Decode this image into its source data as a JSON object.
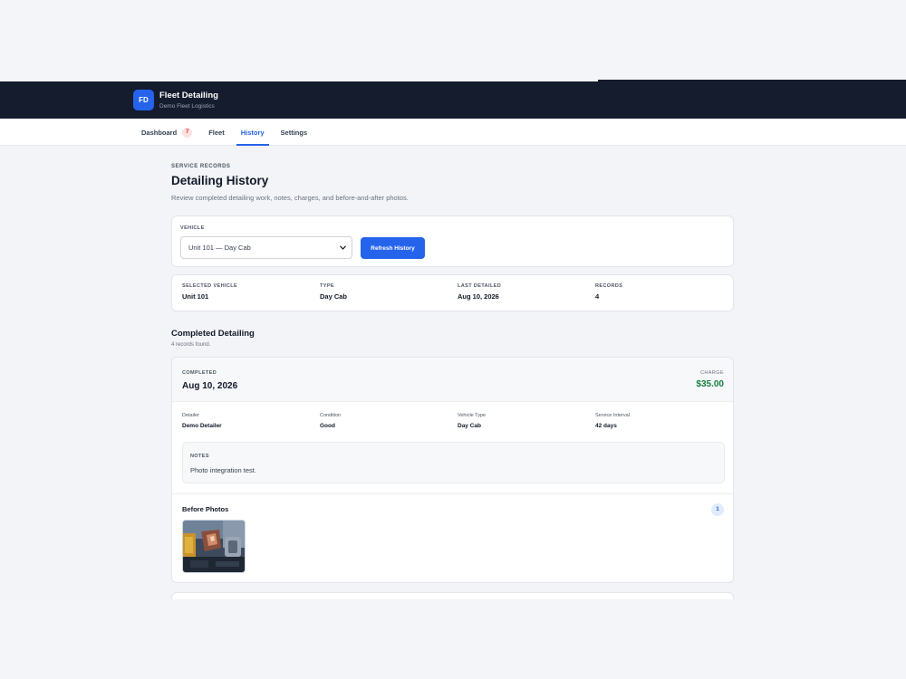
{
  "header": {
    "logo_initials": "FD",
    "app_title": "Fleet Detailing",
    "org_name": "Demo Fleet Logistics"
  },
  "nav": {
    "items": [
      {
        "label": "Dashboard",
        "badge": "7"
      },
      {
        "label": "Fleet"
      },
      {
        "label": "History",
        "active": true
      },
      {
        "label": "Settings"
      }
    ]
  },
  "page": {
    "eyebrow": "SERVICE RECORDS",
    "title": "Detailing History",
    "description": "Review completed detailing work, notes, charges, and before-and-after photos."
  },
  "filter": {
    "label": "VEHICLE",
    "selected": "Unit 101 — Day Cab",
    "button_label": "Refresh History"
  },
  "summary": [
    {
      "label": "SELECTED VEHICLE",
      "value": "Unit 101"
    },
    {
      "label": "TYPE",
      "value": "Day Cab"
    },
    {
      "label": "LAST DETAILED",
      "value": "Aug 10, 2026"
    },
    {
      "label": "RECORDS",
      "value": "4"
    }
  ],
  "records_section": {
    "title": "Completed Detailing",
    "count_text": "4 records found."
  },
  "record": {
    "completed_label": "COMPLETED",
    "date": "Aug 10, 2026",
    "charge_label": "CHARGE",
    "charge": "$35.00",
    "charge_color": "#15803d",
    "details": [
      {
        "label": "Detailer",
        "value": "Demo Detailer"
      },
      {
        "label": "Condition",
        "value": "Good"
      },
      {
        "label": "Vehicle Type",
        "value": "Day Cab"
      },
      {
        "label": "Service Interval",
        "value": "42 days"
      }
    ],
    "notes_label": "NOTES",
    "notes_text": "Photo integration test.",
    "before_photos_label": "Before Photos",
    "before_photos_count": "1"
  },
  "colors": {
    "topbar": "#141c2e",
    "accent": "#2563eb"
  }
}
